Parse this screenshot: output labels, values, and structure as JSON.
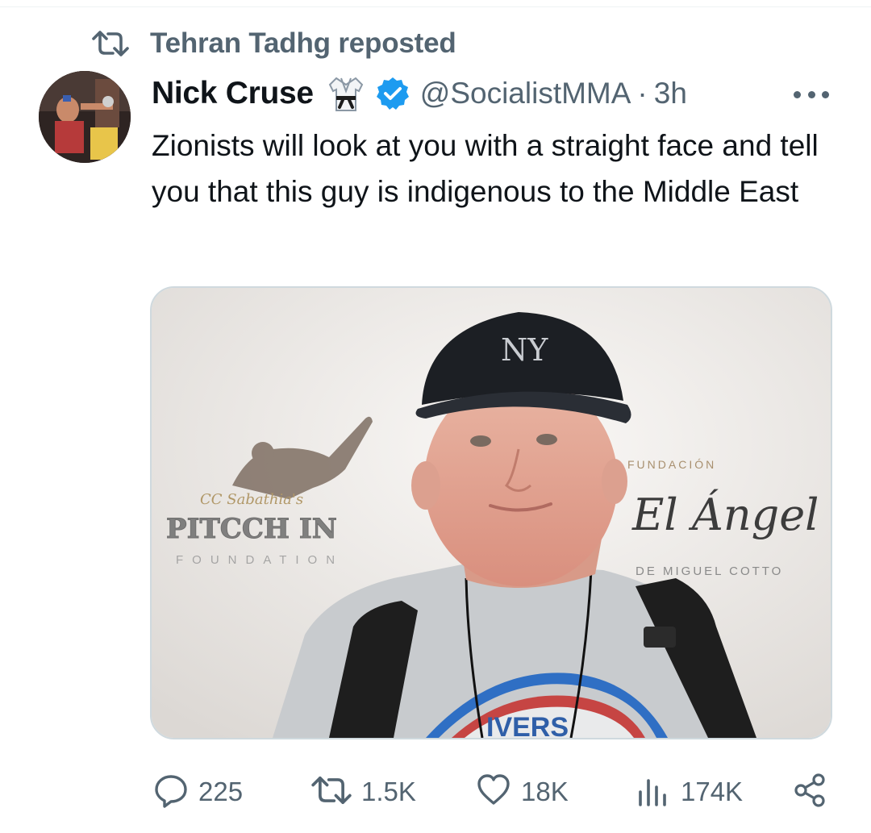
{
  "repost": {
    "label": "Tehran Tadhg reposted",
    "icon": "repost-icon"
  },
  "author": {
    "display_name": "Nick Cruse",
    "handle": "@SocialistMMA",
    "separator": "·",
    "time": "3h",
    "badges": [
      "martial-arts-gi-icon",
      "verified-badge-icon"
    ],
    "verified_color": "#1d9bf0"
  },
  "tweet": {
    "text": "Zionists will look at you with a straight face and tell you that this guy is indigenous to the Middle East"
  },
  "media": {
    "backdrop_text": {
      "left_brand_script": "CC Sabathia's",
      "left_brand": "PITCCH IN",
      "left_brand_sub": "FOUNDATION",
      "right_top": "FUNDACIÓN",
      "right_brand": "El Ángel",
      "right_sub": "DE MIGUEL COTTO"
    },
    "cap_logo": "NY",
    "shirt_text": "IVERS"
  },
  "actions": {
    "replies": "225",
    "reposts": "1.5K",
    "likes": "18K",
    "views": "174K"
  },
  "colors": {
    "text": "#0f1419",
    "secondary": "#536471",
    "border": "#cfd9de",
    "accent": "#1d9bf0"
  }
}
